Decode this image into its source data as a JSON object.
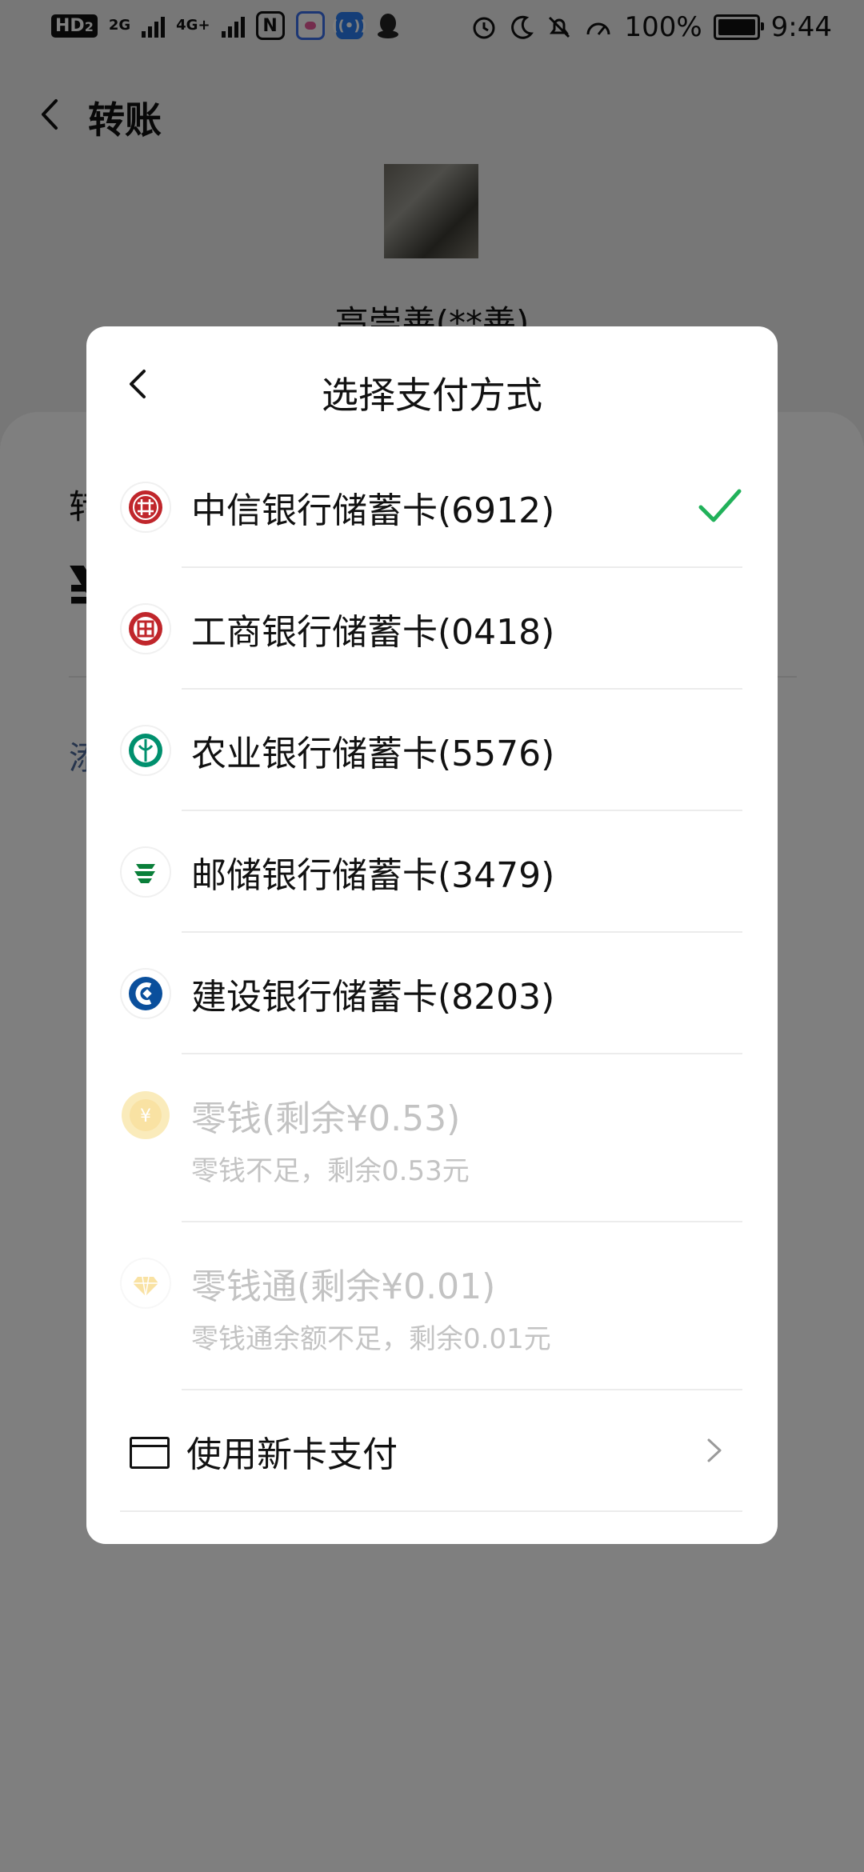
{
  "status_bar": {
    "hd_label": "HD",
    "hd_sub": "2",
    "net1": "2G",
    "net2": "4G+",
    "nfc_icon": "N",
    "battery_pct": "100%",
    "time": "9:44"
  },
  "header": {
    "title": "转账"
  },
  "recipient": {
    "name": "高崇善(**善)"
  },
  "background_form": {
    "amount_label": "转",
    "currency_symbol": "¥",
    "note_link": "添"
  },
  "dialog": {
    "title": "选择支付方式",
    "methods": [
      {
        "label": "中信银行储蓄卡(6912)",
        "icon": "citic-bank-icon",
        "color": "#c0262b",
        "selected": true
      },
      {
        "label": "工商银行储蓄卡(0418)",
        "icon": "icbc-bank-icon",
        "color": "#c0262b",
        "selected": false
      },
      {
        "label": "农业银行储蓄卡(5576)",
        "icon": "abc-bank-icon",
        "color": "#00906e",
        "selected": false
      },
      {
        "label": "邮储银行储蓄卡(3479)",
        "icon": "psbc-bank-icon",
        "color": "#0a7f3a",
        "selected": false
      },
      {
        "label": "建设银行储蓄卡(8203)",
        "icon": "ccb-bank-icon",
        "color": "#0a4f9c",
        "selected": false
      }
    ],
    "balance": {
      "label": "零钱(剩余¥0.53)",
      "sub": "零钱不足，剩余0.53元",
      "icon": "yen-coin-icon"
    },
    "lct": {
      "label": "零钱通(剩余¥0.01)",
      "sub": "零钱通余额不足，剩余0.01元",
      "icon": "diamond-icon"
    },
    "new_card": {
      "label": "使用新卡支付"
    }
  },
  "colors": {
    "check": "#21b15a",
    "coin": "#f4c64a"
  }
}
